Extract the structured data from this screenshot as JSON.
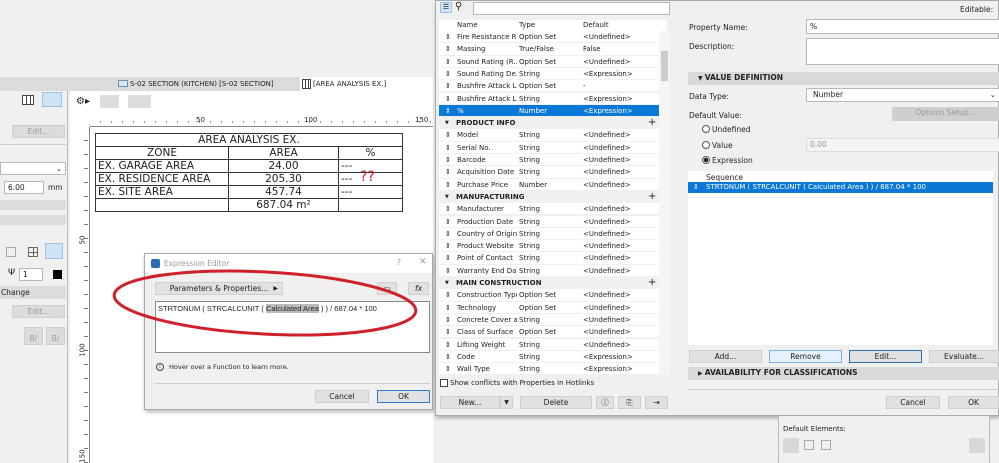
{
  "tabs": [
    {
      "label": "S-02 SECTION (KITCHEN) [S-02 SECTION]"
    },
    {
      "label": "[AREA ANALYSIS EX.]"
    }
  ],
  "left_panel": {
    "edit1": "Edit...",
    "thickness": "6.00",
    "unit": "mm",
    "pen": "1",
    "change": "Change",
    "edit2": "Edit...",
    "undo": "B/",
    "redo": "B/"
  },
  "ruler": {
    "top": [
      "50",
      "100",
      "150"
    ],
    "left": [
      "50",
      "100",
      "150"
    ]
  },
  "schedule": {
    "title": "AREA ANALYSIS EX.",
    "headers": [
      "ZONE",
      "AREA",
      "%"
    ],
    "rows": [
      [
        "EX. GARAGE AREA",
        "24.00",
        "---"
      ],
      [
        "EX. RESIDENCE AREA",
        "205.30",
        "---"
      ],
      [
        "EX. SITE AREA",
        "457.74",
        "---"
      ]
    ],
    "total": "687.04 m²",
    "annotation": "??",
    "annotation_color": "#d0202a"
  },
  "expr_editor": {
    "title": "Expression Editor",
    "help": "?",
    "close": "✕",
    "params_button": "Parameters & Properties...",
    "fx": "fx",
    "expr_pre": "STRTONUM ( STRCALCUNIT ( ",
    "expr_hl": "Calculated Area",
    "expr_post": " ) ) / 687.04 * 100",
    "info": "Hover over a Function to learn more.",
    "cancel": "Cancel",
    "ok": "OK"
  },
  "prop_list": {
    "columns": [
      "Name",
      "Type",
      "Default"
    ],
    "rows": [
      [
        "Fire Resistance R...",
        "Option Set",
        "<Undefined>"
      ],
      [
        "Massing",
        "True/False",
        "False"
      ],
      [
        "Sound Rating (R...",
        "Option Set",
        "<Undefined>"
      ],
      [
        "Sound Rating De...",
        "String",
        "<Expression>"
      ],
      [
        "Bushfire Attack L...",
        "Option Set",
        "-"
      ],
      [
        "Bushfire Attack L...",
        "String",
        "<Expression>"
      ],
      [
        "%",
        "Number",
        "<Expression>",
        "sel"
      ],
      [
        "PRODUCT INFO",
        "",
        "",
        "grp"
      ],
      [
        "Model",
        "String",
        "<Undefined>"
      ],
      [
        "Serial No.",
        "String",
        "<Undefined>"
      ],
      [
        "Barcode",
        "String",
        "<Undefined>"
      ],
      [
        "Acquisition Date",
        "String",
        "<Undefined>"
      ],
      [
        "Purchase Price",
        "Number",
        "<Undefined>"
      ],
      [
        "MANUFACTURING",
        "",
        "",
        "grp"
      ],
      [
        "Manufacturer",
        "String",
        "<Undefined>"
      ],
      [
        "Production Date",
        "String",
        "<Undefined>"
      ],
      [
        "Country of Origin",
        "String",
        "<Undefined>"
      ],
      [
        "Product Website",
        "String",
        "<Undefined>"
      ],
      [
        "Point of Contact",
        "String",
        "<Undefined>"
      ],
      [
        "Warranty End Date",
        "String",
        "<Undefined>"
      ],
      [
        "MAIN CONSTRUCTION",
        "",
        "",
        "grp"
      ],
      [
        "Construction Type",
        "Option Set",
        "<Undefined>"
      ],
      [
        "Technology",
        "Option Set",
        "<Undefined>"
      ],
      [
        "Concrete Cover a...",
        "String",
        "<Undefined>"
      ],
      [
        "Class of Surface",
        "Option Set",
        "<Undefined>"
      ],
      [
        "Lifting Weight",
        "String",
        "<Undefined>"
      ],
      [
        "Code",
        "String",
        "<Expression>"
      ],
      [
        "Wall Type",
        "String",
        "<Expression>"
      ]
    ],
    "show_conflicts": "Show conflicts with Properties in Hotlinks",
    "new": "New...",
    "delete": "Delete"
  },
  "details": {
    "editable": "Editable:",
    "property_name_label": "Property Name:",
    "property_name": "%",
    "description_label": "Description:",
    "value_definition": "VALUE DEFINITION",
    "data_type_label": "Data Type:",
    "data_type": "Number",
    "default_value_label": "Default Value:",
    "options_setup": "Options Setup...",
    "radio_undefined": "Undefined",
    "radio_value": "Value",
    "value": "0.00",
    "radio_expression": "Expression",
    "selected_radio": "Expression",
    "sequence_header": "Sequence",
    "sequence": [
      "STRTONUM ( STRCALCUNIT ( Calculated Area ) ) / 687.04 * 100"
    ],
    "add": "Add...",
    "remove": "Remove",
    "edit": "Edit...",
    "evaluate": "Evaluate...",
    "availability": "AVAILABILITY FOR CLASSIFICATIONS",
    "cancel": "Cancel",
    "ok": "OK"
  },
  "bg_panel": {
    "default_elements": "Default Elements:"
  },
  "colors": {
    "selection": "#0a78d7",
    "ellipse": "#d0202a"
  }
}
